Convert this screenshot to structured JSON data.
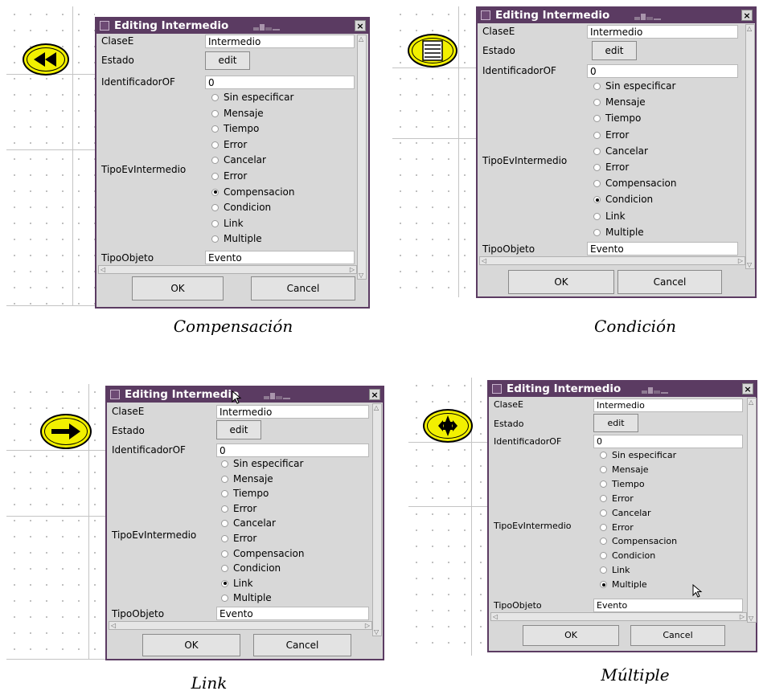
{
  "dialogs": [
    {
      "title": "Editing Intermedio",
      "close": "×",
      "fields": {
        "clase_label": "ClaseE",
        "clase_value": "Intermedio",
        "estado_label": "Estado",
        "estado_button": "edit",
        "id_label": "IdentificadorOF",
        "id_value": "0",
        "tipo_ev_label": "TipoEvIntermedio",
        "tipo_obj_label": "TipoObjeto",
        "tipo_obj_value": "Evento"
      },
      "options": [
        "Sin especificar",
        "Mensaje",
        "Tiempo",
        "Error",
        "Cancelar",
        "Error",
        "Compensacion",
        "Condicion",
        "Link",
        "Multiple"
      ],
      "selected_index": 6,
      "ok": "OK",
      "cancel": "Cancel",
      "caption": "Compensación",
      "event_icon": "rewind-icon"
    },
    {
      "title": "Editing Intermedio",
      "close": "×",
      "fields": {
        "clase_label": "ClaseE",
        "clase_value": "Intermedio",
        "estado_label": "Estado",
        "estado_button": "edit",
        "id_label": "IdentificadorOF",
        "id_value": "0",
        "tipo_ev_label": "TipoEvIntermedio",
        "tipo_obj_label": "TipoObjeto",
        "tipo_obj_value": "Evento"
      },
      "options": [
        "Sin especificar",
        "Mensaje",
        "Tiempo",
        "Error",
        "Cancelar",
        "Error",
        "Compensacion",
        "Condicion",
        "Link",
        "Multiple"
      ],
      "selected_index": 7,
      "ok": "OK",
      "cancel": "Cancel",
      "caption": "Condición",
      "event_icon": "document-lines-icon"
    },
    {
      "title": "Editing Intermedio",
      "close": "×",
      "fields": {
        "clase_label": "ClaseE",
        "clase_value": "Intermedio",
        "estado_label": "Estado",
        "estado_button": "edit",
        "id_label": "IdentificadorOF",
        "id_value": "0",
        "tipo_ev_label": "TipoEvIntermedio",
        "tipo_obj_label": "TipoObjeto",
        "tipo_obj_value": "Evento"
      },
      "options": [
        "Sin especificar",
        "Mensaje",
        "Tiempo",
        "Error",
        "Cancelar",
        "Error",
        "Compensacion",
        "Condicion",
        "Link",
        "Multiple"
      ],
      "selected_index": 8,
      "ok": "OK",
      "cancel": "Cancel",
      "caption": "Link",
      "event_icon": "right-arrow-icon"
    },
    {
      "title": "Editing Intermedio",
      "close": "×",
      "fields": {
        "clase_label": "ClaseE",
        "clase_value": "Intermedio",
        "estado_label": "Estado",
        "estado_button": "edit",
        "id_label": "IdentificadorOF",
        "id_value": "0",
        "tipo_ev_label": "TipoEvIntermedio",
        "tipo_obj_label": "TipoObjeto",
        "tipo_obj_value": "Evento"
      },
      "options": [
        "Sin especificar",
        "Mensaje",
        "Tiempo",
        "Error",
        "Cancelar",
        "Error",
        "Compensacion",
        "Condicion",
        "Link",
        "Multiple"
      ],
      "selected_index": 9,
      "ok": "OK",
      "cancel": "Cancel",
      "caption": "Múltiple",
      "event_icon": "star-icon"
    }
  ],
  "colors": {
    "titlebar": "#5b3b62",
    "dialog_bg": "#d8d8d8",
    "event_fill": "#f2f000"
  }
}
